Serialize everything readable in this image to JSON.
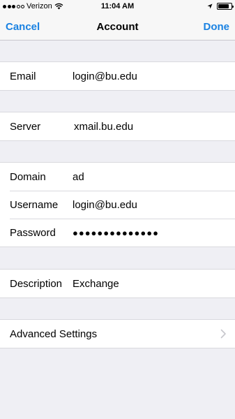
{
  "status_bar": {
    "carrier": "Verizon",
    "time": "11:04 AM",
    "signal_bars_filled": 3,
    "signal_bars_total": 5,
    "battery_level": 0.85
  },
  "nav": {
    "cancel_label": "Cancel",
    "title": "Account",
    "done_label": "Done",
    "accent_color": "#1a82e2"
  },
  "account": {
    "email_label": "Email",
    "email_value": "login@bu.edu",
    "server_label": "Server",
    "server_value": "xmail.bu.edu",
    "domain_label": "Domain",
    "domain_value": "ad",
    "username_label": "Username",
    "username_value": "login@bu.edu",
    "password_label": "Password",
    "password_value": "●●●●●●●●●●●●●●",
    "description_label": "Description",
    "description_value": "Exchange",
    "advanced_label": "Advanced Settings"
  }
}
